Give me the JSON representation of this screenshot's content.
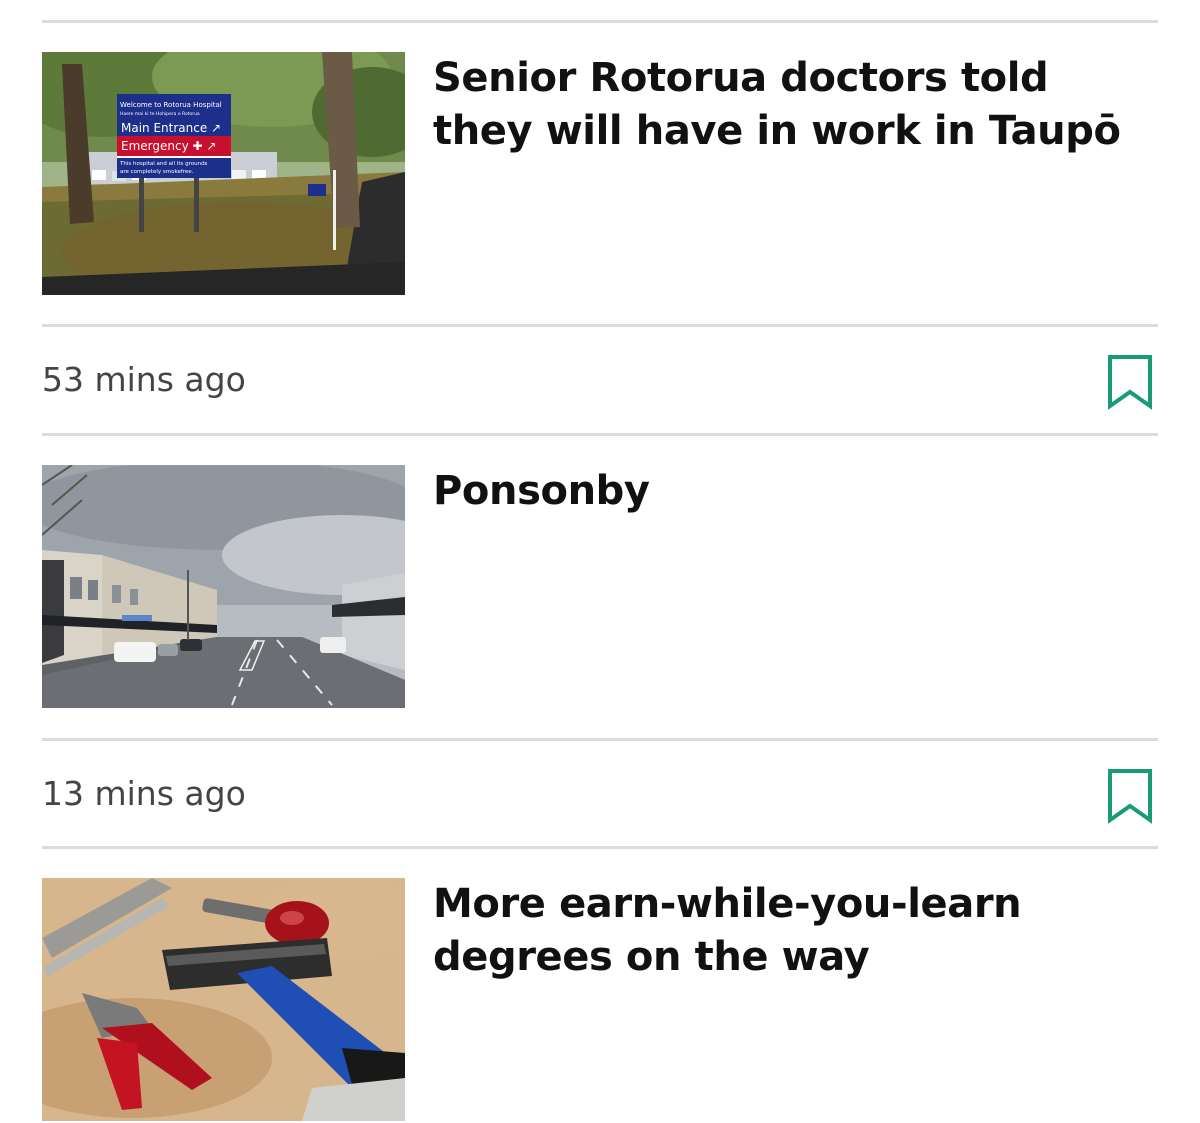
{
  "feed": {
    "stories": [
      {
        "headline": "Senior Rotorua doctors told they will have in work in Taupō",
        "image": {
          "subject": "rotorua-hospital-entrance-sign",
          "sign_lines": [
            "Welcome to Rotorua Hospital",
            "Haere mai ki te Hohipera o Rotorua",
            "Main Entrance",
            "Emergency",
            "This hospital and all its grounds",
            "are completely smokefree."
          ]
        }
      },
      {
        "headline": "Ponsonby",
        "image": {
          "subject": "ponsonby-road-street-scene"
        }
      },
      {
        "headline": "More earn-while-you-learn degrees on the way",
        "image": {
          "subject": "hammer-and-pliers-on-workbench"
        }
      }
    ],
    "meta": [
      {
        "timestamp": "53 mins ago",
        "bookmark_icon": "bookmark-outline-icon"
      },
      {
        "timestamp": "13 mins ago",
        "bookmark_icon": "bookmark-outline-icon"
      }
    ]
  },
  "colors": {
    "accent": "#1a9b78",
    "divider": "#dcdcdc",
    "headline": "#111111",
    "timestamp": "#444444",
    "sign_blue": "#1c2f8a",
    "sign_red": "#c8102e"
  }
}
